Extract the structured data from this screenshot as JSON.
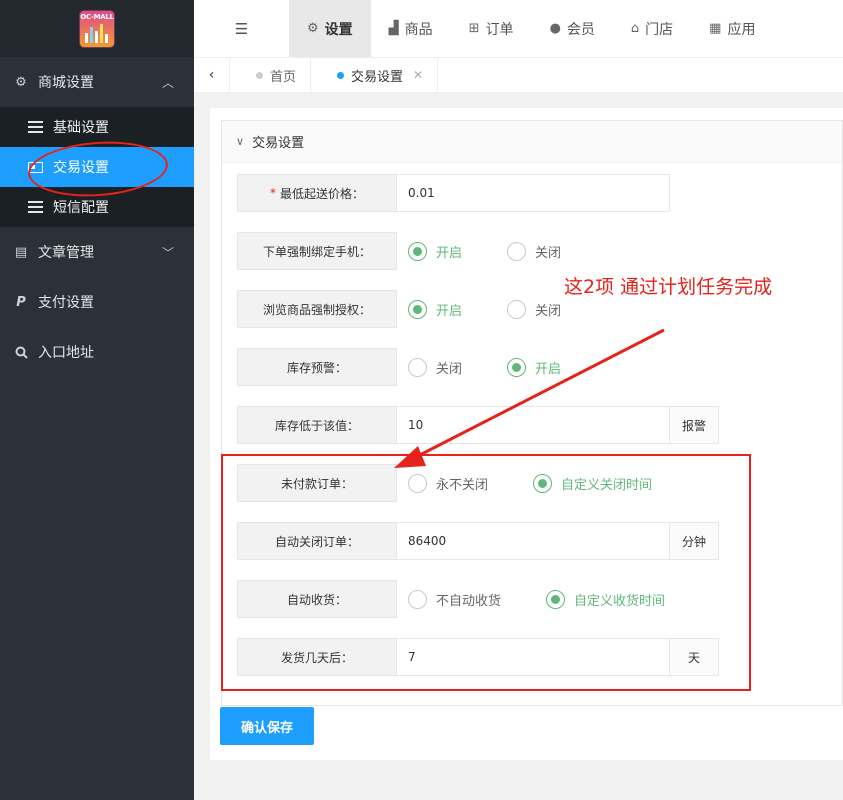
{
  "sidebar": {
    "logo_text": "OC-MALL",
    "groups": [
      {
        "label": "商城设置",
        "icon": "gear-icon",
        "expanded": true
      },
      {
        "label": "文章管理",
        "icon": "newspaper-icon",
        "expanded": false
      },
      {
        "label": "支付设置",
        "icon": "paypal-icon"
      },
      {
        "label": "入口地址",
        "icon": "search-icon"
      }
    ],
    "sub_items": [
      {
        "label": "基础设置",
        "active": false
      },
      {
        "label": "交易设置",
        "active": true
      },
      {
        "label": "短信配置",
        "active": false
      }
    ]
  },
  "topnav": {
    "items": [
      {
        "label": "设置",
        "icon": "gears-icon",
        "active": true
      },
      {
        "label": "商品",
        "icon": "shopping-bag-icon"
      },
      {
        "label": "订单",
        "icon": "grid-table-icon"
      },
      {
        "label": "会员",
        "icon": "user-icon"
      },
      {
        "label": "门店",
        "icon": "bank-icon"
      },
      {
        "label": "应用",
        "icon": "apps-icon"
      }
    ]
  },
  "tabs": [
    {
      "label": "首页",
      "active": false
    },
    {
      "label": "交易设置",
      "active": true,
      "closable": true
    }
  ],
  "card": {
    "title": "交易设置",
    "fields": {
      "min_price": {
        "label": "最低起送价格：",
        "value": "0.01",
        "required": true
      },
      "bind_phone": {
        "label": "下单强制绑定手机：",
        "options": [
          "开启",
          "关闭"
        ],
        "selected": "开启"
      },
      "browse_auth": {
        "label": "浏览商品强制授权：",
        "options": [
          "开启",
          "关闭"
        ],
        "selected": "开启"
      },
      "stock_alert": {
        "label": "库存预警：",
        "options": [
          "关闭",
          "开启"
        ],
        "selected": "开启"
      },
      "stock_threshold": {
        "label": "库存低于该值：",
        "value": "10",
        "addon": "报警"
      },
      "unpaid_order": {
        "label": "未付款订单：",
        "options": [
          "永不关闭",
          "自定义关闭时间"
        ],
        "selected": "自定义关闭时间"
      },
      "auto_close": {
        "label": "自动关闭订单：",
        "value": "86400",
        "addon": "分钟"
      },
      "auto_receive": {
        "label": "自动收货：",
        "options": [
          "不自动收货",
          "自定义收货时间"
        ],
        "selected": "自定义收货时间"
      },
      "ship_days": {
        "label": "发货几天后：",
        "value": "7",
        "addon": "天"
      }
    },
    "save_label": "确认保存"
  },
  "annotation": {
    "text": "这2项 通过计划任务完成",
    "color": "#e5231b"
  },
  "colors": {
    "sidebar_bg": "#2a3139",
    "active_blue": "#1e9fff",
    "radio_green": "#5fb878"
  }
}
